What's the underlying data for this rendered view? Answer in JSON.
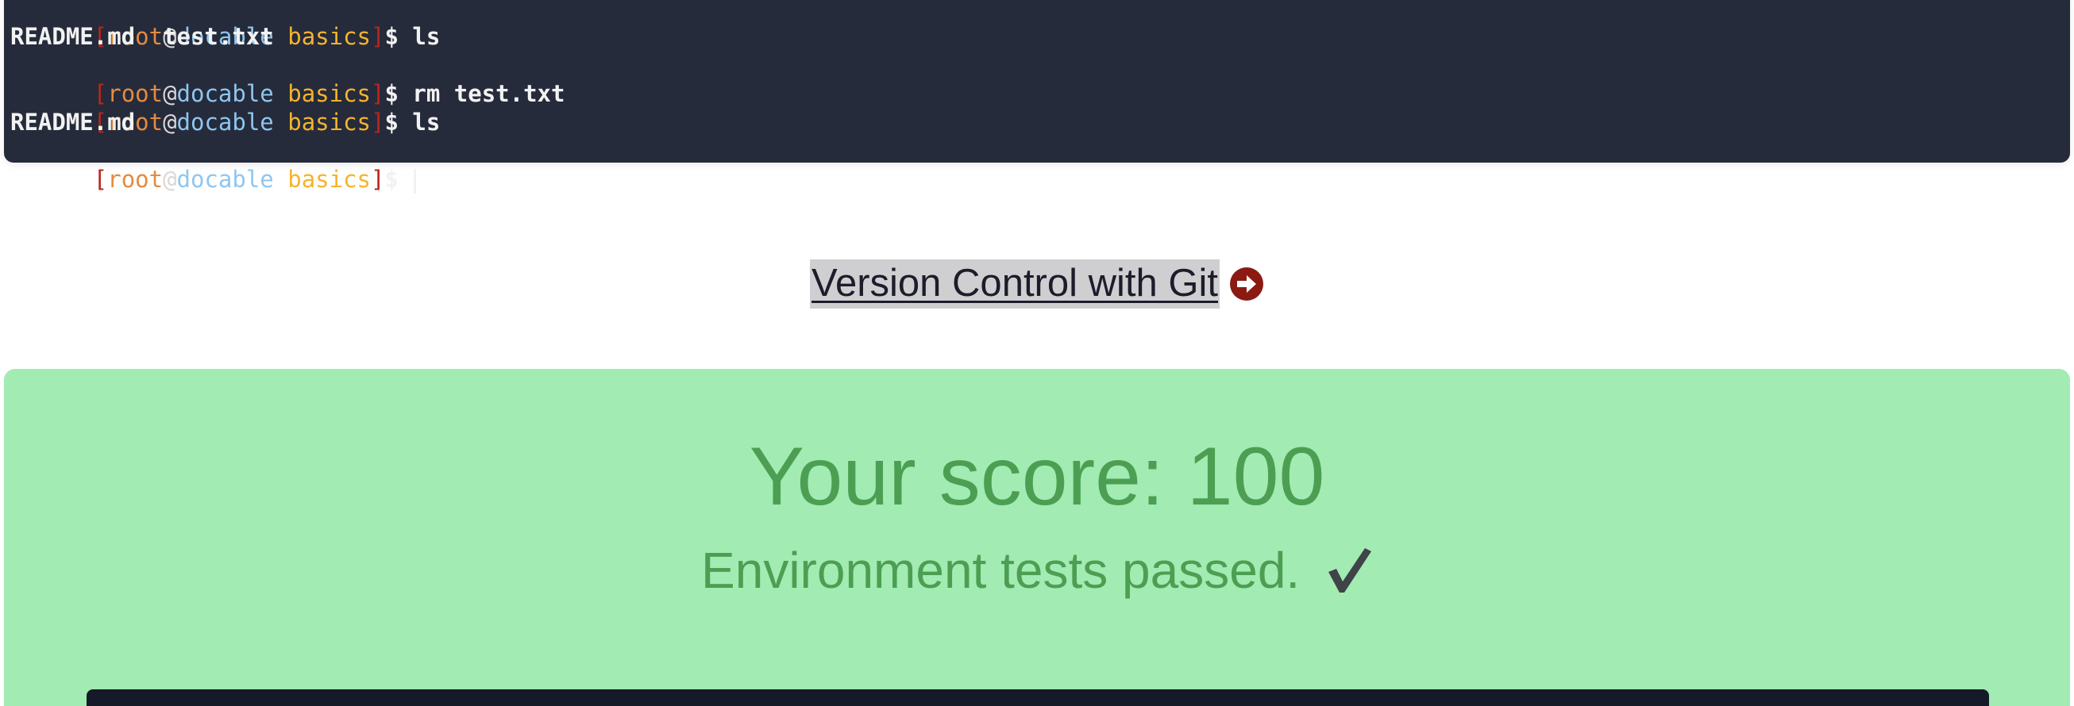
{
  "terminal": {
    "prompt": {
      "open_bracket": "[",
      "user": "root",
      "at": "@",
      "host": "docable",
      "dir": "basics",
      "close_bracket": "]",
      "dollar": "$"
    },
    "lines": [
      {
        "type": "prompt",
        "command": "ls"
      },
      {
        "type": "output",
        "text": "README.md  test.txt"
      },
      {
        "type": "prompt",
        "command": "rm test.txt"
      },
      {
        "type": "prompt",
        "command": "ls"
      },
      {
        "type": "output",
        "text": "README.md"
      },
      {
        "type": "prompt",
        "command": ""
      }
    ]
  },
  "next_lesson": {
    "label": "Version Control with Git",
    "icon": "arrow-circle-right-icon",
    "icon_color": "#8b1a12"
  },
  "score": {
    "title": "Your score: 100",
    "status": "Environment tests passed.",
    "status_icon": "checkmark-icon",
    "panel_color": "#a2ebb2",
    "text_color": "#4c9f52"
  }
}
